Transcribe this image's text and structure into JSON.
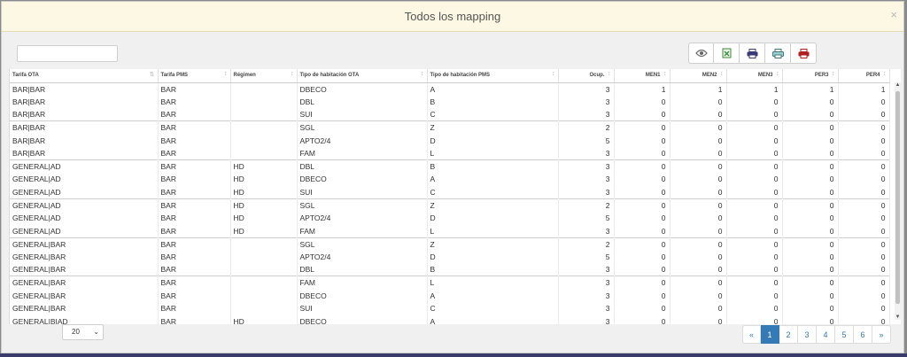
{
  "modal": {
    "title": "Todos los mapping",
    "close": "×"
  },
  "search": {
    "value": "",
    "placeholder": ""
  },
  "toolbar": [
    {
      "icon": "eye-icon",
      "color": "#666666"
    },
    {
      "icon": "excel-export-icon",
      "color": "#3c8a3c"
    },
    {
      "icon": "print-icon",
      "color": "#3a3a7a"
    },
    {
      "icon": "printer-preview-icon",
      "color": "#3a7a7a"
    },
    {
      "icon": "pdf-export-icon",
      "color": "#b02020"
    }
  ],
  "table": {
    "columns": [
      {
        "label": "Tarifa OTA",
        "align": "left"
      },
      {
        "label": "Tarifa PMS",
        "align": "left"
      },
      {
        "label": "Régimen",
        "align": "left"
      },
      {
        "label": "Tipo de habitación OTA",
        "align": "left"
      },
      {
        "label": "Tipo de habitación PMS",
        "align": "left"
      },
      {
        "label": "Ocup.",
        "align": "right"
      },
      {
        "label": "MEN1",
        "align": "right"
      },
      {
        "label": "MEN2",
        "align": "right"
      },
      {
        "label": "MEN3",
        "align": "right"
      },
      {
        "label": "PER3",
        "align": "right"
      },
      {
        "label": "PER4",
        "align": "right"
      }
    ],
    "rows": [
      [
        "BAR|BAR",
        "BAR",
        "",
        "DBECO",
        "A",
        "3",
        "1",
        "1",
        "1",
        "1",
        "1"
      ],
      [
        "BAR|BAR",
        "BAR",
        "",
        "DBL",
        "B",
        "3",
        "0",
        "0",
        "0",
        "0",
        "0"
      ],
      [
        "BAR|BAR",
        "BAR",
        "",
        "SUI",
        "C",
        "3",
        "0",
        "0",
        "0",
        "0",
        "0"
      ],
      [
        "BAR|BAR",
        "BAR",
        "",
        "SGL",
        "Z",
        "2",
        "0",
        "0",
        "0",
        "0",
        "0"
      ],
      [
        "BAR|BAR",
        "BAR",
        "",
        "APTO2/4",
        "D",
        "5",
        "0",
        "0",
        "0",
        "0",
        "0"
      ],
      [
        "BAR|BAR",
        "BAR",
        "",
        "FAM",
        "L",
        "3",
        "0",
        "0",
        "0",
        "0",
        "0"
      ],
      [
        "GENERAL|AD",
        "BAR",
        "HD",
        "DBL",
        "B",
        "3",
        "0",
        "0",
        "0",
        "0",
        "0"
      ],
      [
        "GENERAL|AD",
        "BAR",
        "HD",
        "DBECO",
        "A",
        "3",
        "0",
        "0",
        "0",
        "0",
        "0"
      ],
      [
        "GENERAL|AD",
        "BAR",
        "HD",
        "SUI",
        "C",
        "3",
        "0",
        "0",
        "0",
        "0",
        "0"
      ],
      [
        "GENERAL|AD",
        "BAR",
        "HD",
        "SGL",
        "Z",
        "2",
        "0",
        "0",
        "0",
        "0",
        "0"
      ],
      [
        "GENERAL|AD",
        "BAR",
        "HD",
        "APTO2/4",
        "D",
        "5",
        "0",
        "0",
        "0",
        "0",
        "0"
      ],
      [
        "GENERAL|AD",
        "BAR",
        "HD",
        "FAM",
        "L",
        "3",
        "0",
        "0",
        "0",
        "0",
        "0"
      ],
      [
        "GENERAL|BAR",
        "BAR",
        "",
        "SGL",
        "Z",
        "2",
        "0",
        "0",
        "0",
        "0",
        "0"
      ],
      [
        "GENERAL|BAR",
        "BAR",
        "",
        "APTO2/4",
        "D",
        "5",
        "0",
        "0",
        "0",
        "0",
        "0"
      ],
      [
        "GENERAL|BAR",
        "BAR",
        "",
        "DBL",
        "B",
        "3",
        "0",
        "0",
        "0",
        "0",
        "0"
      ],
      [
        "GENERAL|BAR",
        "BAR",
        "",
        "FAM",
        "L",
        "3",
        "0",
        "0",
        "0",
        "0",
        "0"
      ],
      [
        "GENERAL|BAR",
        "BAR",
        "",
        "DBECO",
        "A",
        "3",
        "0",
        "0",
        "0",
        "0",
        "0"
      ],
      [
        "GENERAL|BAR",
        "BAR",
        "",
        "SUI",
        "C",
        "3",
        "0",
        "0",
        "0",
        "0",
        "0"
      ],
      [
        "GENERAL|BIAD",
        "BAR",
        "HD",
        "DBECO",
        "A",
        "3",
        "0",
        "0",
        "0",
        "0",
        "0"
      ]
    ],
    "separator_rows": [
      3,
      6,
      9,
      12,
      15
    ]
  },
  "pagination": {
    "page_size": "20",
    "prev": "«",
    "next": "»",
    "pages": [
      "1",
      "2",
      "3",
      "4",
      "5",
      "6"
    ],
    "active": "1"
  }
}
